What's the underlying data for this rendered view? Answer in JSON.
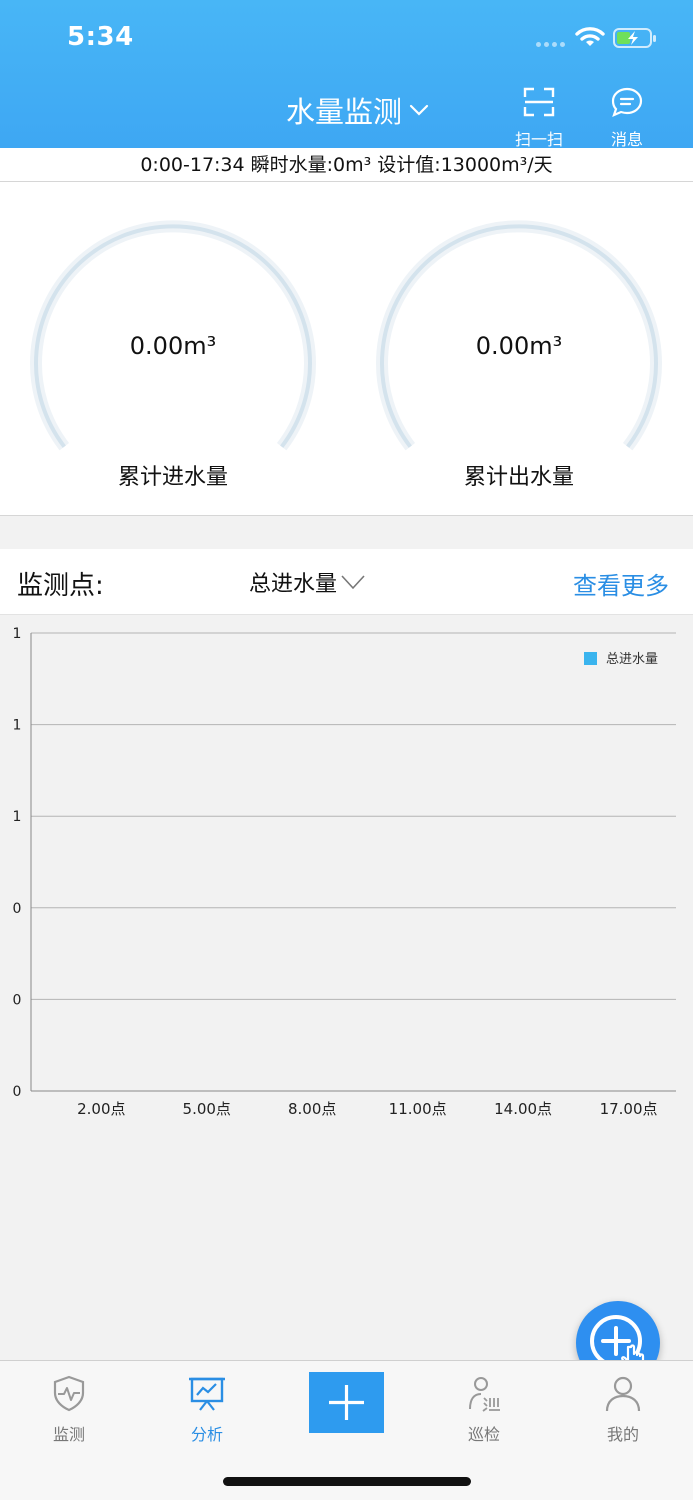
{
  "status_bar": {
    "time": "5:34"
  },
  "header": {
    "title": "水量监测",
    "scan_label": "扫一扫",
    "message_label": "消息"
  },
  "info": {
    "text": "0:00-17:34 瞬时水量:0m³ 设计值:13000m³/天"
  },
  "gauges": [
    {
      "value": "0.00m³",
      "label": "累计进水量"
    },
    {
      "value": "0.00m³",
      "label": "累计出水量"
    }
  ],
  "monitor": {
    "label": "监测点:",
    "selected": "总进水量",
    "more": "查看更多"
  },
  "chart_data": {
    "type": "line",
    "x_tick_labels": [
      "2.00点",
      "5.00点",
      "8.00点",
      "11.00点",
      "14.00点",
      "17.00点"
    ],
    "y_tick_labels": [
      "1",
      "1",
      "1",
      "0",
      "0",
      "0"
    ],
    "series": [
      {
        "name": "总进水量",
        "color": "#3ab4ee",
        "values": []
      }
    ],
    "legend_position": "top-right",
    "grid": true
  },
  "tabs": [
    {
      "label": "监测",
      "icon": "shield-pulse-icon",
      "active": false
    },
    {
      "label": "分析",
      "icon": "chart-board-icon",
      "active": true
    },
    {
      "label": "",
      "icon": "plus-icon",
      "active": false
    },
    {
      "label": "巡检",
      "icon": "patrol-icon",
      "active": false
    },
    {
      "label": "我的",
      "icon": "user-icon",
      "active": false
    }
  ],
  "colors": {
    "header_blue": "#42aef5",
    "accent_blue": "#2a8ee4",
    "legend_blue": "#3ab4ee"
  }
}
